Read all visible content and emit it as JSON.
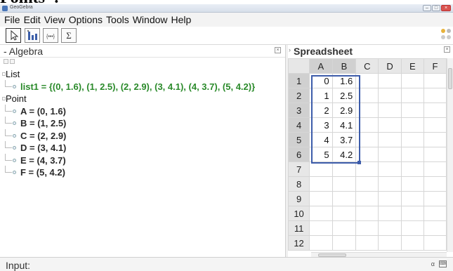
{
  "top_text": "Points\".",
  "window": {
    "title": "GeoGebra"
  },
  "menu": [
    "File",
    "Edit",
    "View",
    "Options",
    "Tools",
    "Window",
    "Help"
  ],
  "toolbar": {
    "tools": [
      {
        "name": "move-tool",
        "icon": "arrow-cursor-icon"
      },
      {
        "name": "two-variable-analysis-tool",
        "icon": "bar-chart-icon"
      },
      {
        "name": "create-list-tool",
        "icon": "list-icon",
        "label": "{•••}"
      },
      {
        "name": "sum-tool",
        "icon": "sigma-icon",
        "label": "Σ"
      }
    ]
  },
  "algebra": {
    "title": "Algebra",
    "groups": [
      {
        "label": "List",
        "type": "list",
        "items": [
          "list1 = {(0, 1.6), (1, 2.5), (2, 2.9), (3, 4.1), (4, 3.7), (5, 4.2)}"
        ]
      },
      {
        "label": "Point",
        "type": "point",
        "items": [
          "A = (0, 1.6)",
          "B = (1, 2.5)",
          "C = (2, 2.9)",
          "D = (3, 4.1)",
          "E = (4, 3.7)",
          "F = (5, 4.2)"
        ]
      }
    ]
  },
  "spreadsheet": {
    "title": "Spreadsheet",
    "columns": [
      "A",
      "B",
      "C",
      "D",
      "E",
      "F"
    ],
    "rows": [
      "1",
      "2",
      "3",
      "4",
      "5",
      "6",
      "7",
      "8",
      "9",
      "10",
      "11",
      "12"
    ],
    "cells": [
      [
        "0",
        "1.6"
      ],
      [
        "1",
        "2.5"
      ],
      [
        "2",
        "2.9"
      ],
      [
        "3",
        "4.1"
      ],
      [
        "4",
        "3.7"
      ],
      [
        "5",
        "4.2"
      ]
    ]
  },
  "input": {
    "label": "Input:",
    "value": "",
    "placeholder": ""
  },
  "colors": {
    "list_text": "#2a8a2a",
    "selection": "#3d5caa"
  }
}
